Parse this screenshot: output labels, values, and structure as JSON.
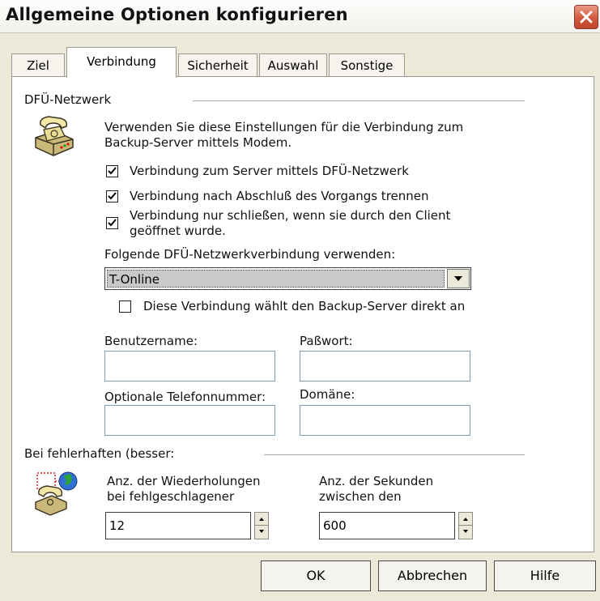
{
  "window": {
    "title": "Allgemeine Optionen konfigurieren"
  },
  "tabs": [
    {
      "label": "Ziel",
      "active": false
    },
    {
      "label": "Verbindung",
      "active": true
    },
    {
      "label": "Sicherheit",
      "active": false
    },
    {
      "label": "Auswahl",
      "active": false
    },
    {
      "label": "Sonstige",
      "active": false
    }
  ],
  "dialup": {
    "group_label": "DFÜ-Netzwerk",
    "description_line1": "Verwenden Sie diese Einstellungen für die Verbindung zum",
    "description_line2": "Backup-Server mittels Modem.",
    "options": [
      {
        "label": "Verbindung zum Server mittels DFÜ-Netzwerk",
        "checked": true
      },
      {
        "label": "Verbindung nach Abschluß des Vorgangs trennen",
        "checked": true
      },
      {
        "label_line1": "Verbindung nur schließen, wenn sie durch den Client",
        "label_line2": "geöffnet wurde.",
        "checked": true
      }
    ],
    "connection_label": "Folgende DFÜ-Netzwerkverbindung verwenden:",
    "connection_value": "T-Online",
    "direct_dial": {
      "label": "Diese Verbindung wählt den Backup-Server direkt an",
      "checked": false
    },
    "username_label": "Benutzername:",
    "username_value": "",
    "password_label": "Paßwort:",
    "password_value": "",
    "phone_label": "Optionale Telefonnummer:",
    "phone_value": "",
    "domain_label": "Domäne:",
    "domain_value": ""
  },
  "retry": {
    "group_label": "Bei fehlerhaften (besser:",
    "retries_label_line1": "Anz. der Wiederholungen",
    "retries_label_line2": "bei fehlgeschlagener",
    "retries_value": "12",
    "seconds_label_line1": "Anz. der Sekunden",
    "seconds_label_line2": "zwischen den",
    "seconds_value": "600"
  },
  "buttons": {
    "ok": "OK",
    "cancel": "Abbrechen",
    "help": "Hilfe"
  }
}
